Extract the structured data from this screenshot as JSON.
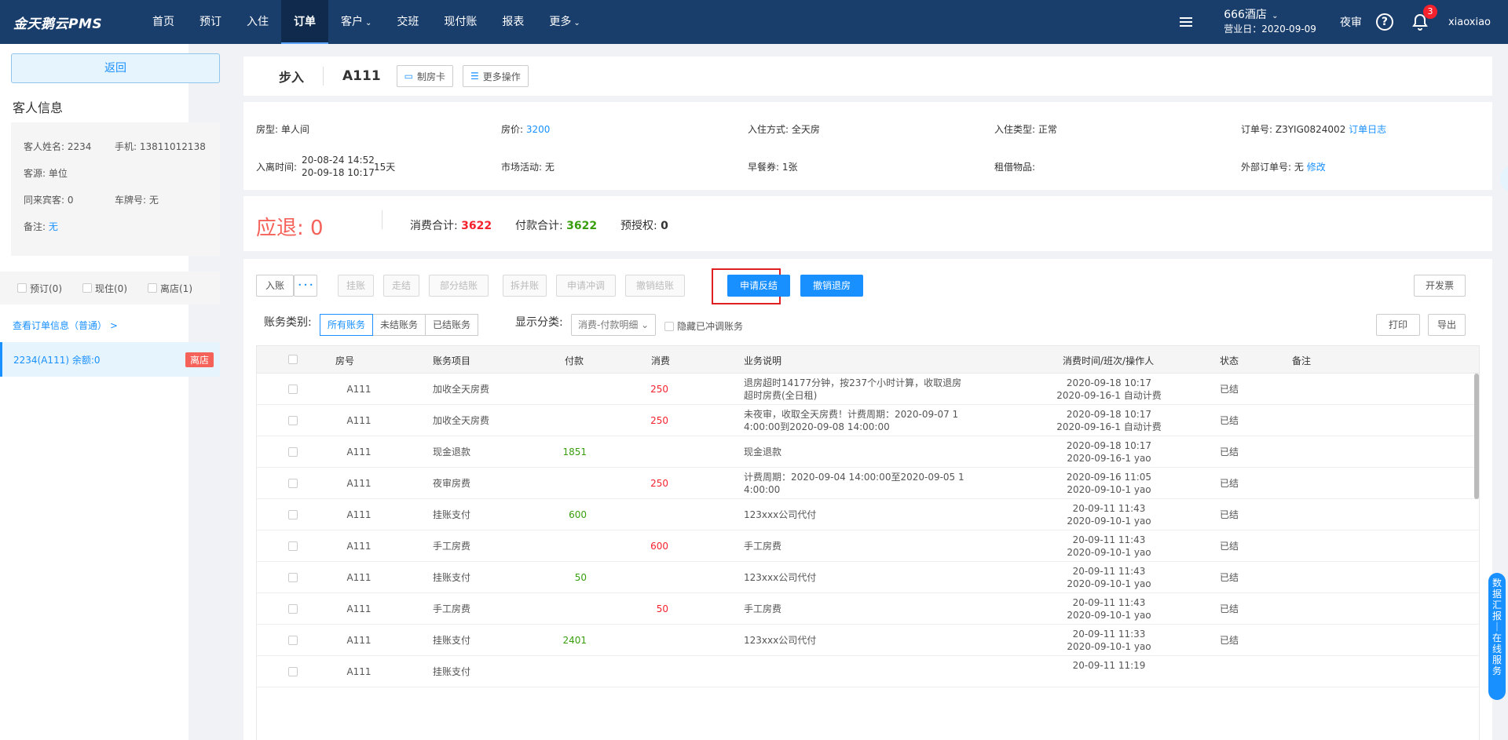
{
  "app": {
    "logo": "金天鹅云PMS"
  },
  "nav": [
    "首页",
    "预订",
    "入住",
    "订单",
    "客户",
    "交班",
    "现付账",
    "报表",
    "更多"
  ],
  "top": {
    "hotel": "666酒店",
    "business_date": "营业日：2020-09-09",
    "night_audit": "夜审",
    "notif_count": "3",
    "user": "xiaoxiao"
  },
  "sidebar": {
    "back": "返回",
    "guest_title": "客人信息",
    "name_label": "客人姓名: 2234",
    "phone": "手机: 13811012138",
    "source": "客源: 单位",
    "companions": "同来宾客: 0",
    "plate": "车牌号: 无",
    "remark_label": "备注: ",
    "remark_link": "无",
    "tabs": [
      "预订(0)",
      "现住(0)",
      "离店(1)"
    ],
    "view_order": "查看订单信息（普通）  >",
    "guest_item": "2234(A111)   余额:0",
    "guest_tag": "离店"
  },
  "order": {
    "type": "步入",
    "room": "A111",
    "make_card": "制房卡",
    "more_ops": "更多操作",
    "room_type": "房型: 单人间",
    "price_label": "房价: ",
    "price": "3200",
    "checkin_mode": "入住方式: 全天房",
    "checkin_type": "入住类型: 正常",
    "order_no": "订单号: Z3YIG0824002",
    "order_log": "订单日志",
    "stay_label": "入离时间:",
    "stay_in": "20-08-24 14:52",
    "stay_out": "20-09-18 10:17",
    "nights": "15天",
    "market": "市场活动: 无",
    "breakfast": "早餐券: 1张",
    "rental": "租借物品:",
    "ext_label": "外部订单号: 无 ",
    "ext_edit": "修改"
  },
  "summary": {
    "refund": "应退: 0",
    "consume_label": "消费合计: ",
    "consume": "3622",
    "pay_label": "付款合计: ",
    "pay": "3622",
    "preauth_label": "预授权: ",
    "preauth": "0"
  },
  "actions": {
    "post": "入账",
    "dots": "• • •",
    "b1": "挂账",
    "b2": "走结",
    "b3": "部分结账",
    "b4": "拆并账",
    "b5": "申请冲调",
    "b6": "撤销结账",
    "apply": "申请反结",
    "cancel_checkout": "撤销退房",
    "invoice": "开发票",
    "print": "打印",
    "export": "导出"
  },
  "filters": {
    "cat_label": "账务类别:",
    "cats": [
      "所有账务",
      "未结账务",
      "已结账务"
    ],
    "display_label": "显示分类:",
    "display_value": "消费-付款明细",
    "hide_label": "隐藏已冲调账务"
  },
  "table": {
    "headers": [
      "房号",
      "账务项目",
      "付款",
      "消费",
      "业务说明",
      "消费时间/班次/操作人",
      "状态",
      "备注"
    ],
    "rows": [
      {
        "room": "A111",
        "item": "加收全天房费",
        "pay": "",
        "consume": "250",
        "desc1": "退房超时14177分钟，按237个小时计算，收取退房",
        "desc2": "超时房费(全日租)",
        "t1": "2020-09-18 10:17",
        "t2": "2020-09-16-1 自动计费",
        "status": "已结"
      },
      {
        "room": "A111",
        "item": "加收全天房费",
        "pay": "",
        "consume": "250",
        "desc1": "未夜审，收取全天房费！计费周期：2020-09-07 1",
        "desc2": "4:00:00到2020-09-08 14:00:00",
        "t1": "2020-09-18 10:17",
        "t2": "2020-09-16-1 自动计费",
        "status": "已结"
      },
      {
        "room": "A111",
        "item": "现金退款",
        "pay": "1851",
        "consume": "",
        "desc1": "现金退款",
        "desc2": "",
        "t1": "2020-09-18 10:17",
        "t2": "2020-09-16-1 yao",
        "status": "已结"
      },
      {
        "room": "A111",
        "item": "夜审房费",
        "pay": "",
        "consume": "250",
        "desc1": "计费周期：2020-09-04 14:00:00至2020-09-05 1",
        "desc2": "4:00:00",
        "t1": "2020-09-16 11:05",
        "t2": "2020-09-10-1 yao",
        "status": "已结"
      },
      {
        "room": "A111",
        "item": "挂账支付",
        "pay": "600",
        "consume": "",
        "desc1": "123xxx公司代付",
        "desc2": "",
        "t1": "20-09-11 11:43",
        "t2": "2020-09-10-1 yao",
        "status": "已结"
      },
      {
        "room": "A111",
        "item": "手工房费",
        "pay": "",
        "consume": "600",
        "desc1": "手工房费",
        "desc2": "",
        "t1": "20-09-11 11:43",
        "t2": "2020-09-10-1 yao",
        "status": "已结"
      },
      {
        "room": "A111",
        "item": "挂账支付",
        "pay": "50",
        "consume": "",
        "desc1": "123xxx公司代付",
        "desc2": "",
        "t1": "20-09-11 11:43",
        "t2": "2020-09-10-1 yao",
        "status": "已结"
      },
      {
        "room": "A111",
        "item": "手工房费",
        "pay": "",
        "consume": "50",
        "desc1": "手工房费",
        "desc2": "",
        "t1": "20-09-11 11:43",
        "t2": "2020-09-10-1 yao",
        "status": "已结"
      },
      {
        "room": "A111",
        "item": "挂账支付",
        "pay": "2401",
        "consume": "",
        "desc1": "123xxx公司代付",
        "desc2": "",
        "t1": "20-09-11 11:33",
        "t2": "2020-09-10-1 yao",
        "status": "已结"
      },
      {
        "room": "A111",
        "item": "挂账支付",
        "pay": "",
        "consume": "",
        "desc1": "",
        "desc2": "",
        "t1": "20-09-11 11:19",
        "t2": "",
        "status": ""
      }
    ]
  },
  "floating": "数据汇报｜在线服务"
}
